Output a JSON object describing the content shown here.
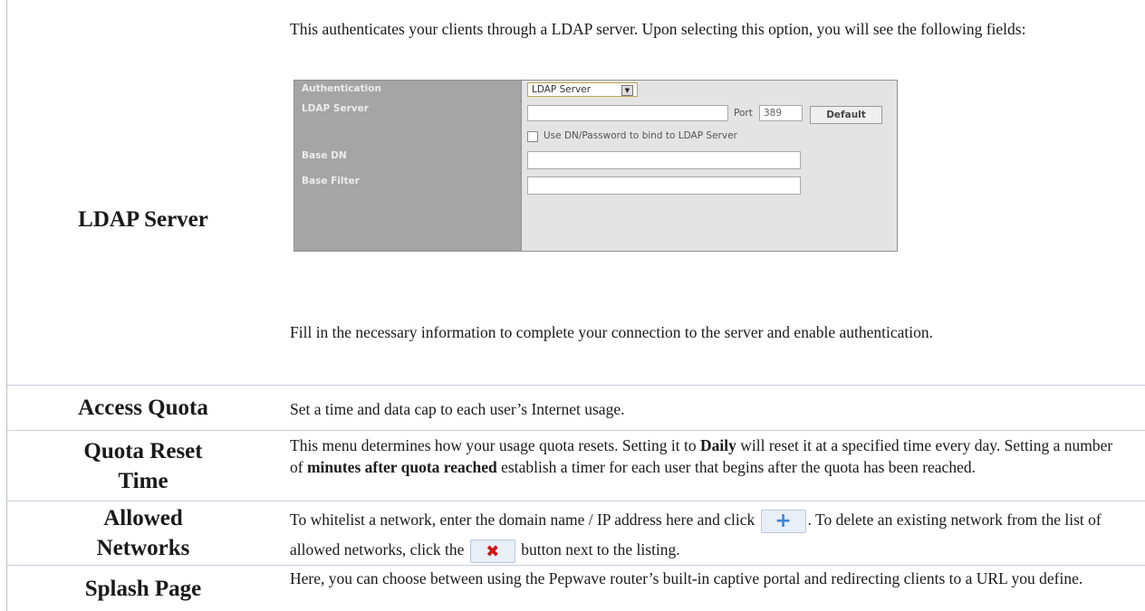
{
  "ldap": {
    "term": "LDAP Server",
    "intro": "This authenticates your clients through a LDAP server. Upon selecting this option, you will see the following fields:",
    "form": {
      "authentication_label": "Authentication",
      "authentication_value": "LDAP Server",
      "ldap_server_label": "LDAP Server",
      "port_label": "Port",
      "port_value": "389",
      "default_button": "Default",
      "bind_checkbox_label": "Use DN/Password to bind to LDAP Server",
      "base_dn_label": "Base DN",
      "base_filter_label": "Base Filter"
    },
    "outro": "Fill in the necessary information to complete your connection to the server and enable authentication."
  },
  "access_quota": {
    "term": "Access Quota",
    "desc": "Set a time and data cap to each user’s Internet usage."
  },
  "quota_reset": {
    "term": "Quota Reset Time",
    "desc_1": "This menu determines how your usage quota resets. Setting it to ",
    "desc_bold_1": "Daily",
    "desc_2": " will reset it at a specified time every day. Setting a number of ",
    "desc_bold_2": "minutes after quota reached",
    "desc_3": " establish a timer for each user that begins after the quota has been reached."
  },
  "allowed_networks": {
    "term": "Allowed Networks",
    "desc_1": "To whitelist a network, enter the domain name / IP address here and click ",
    "add_icon": "plus-icon",
    "desc_2": ". To delete an existing network from the list of allowed networks, click the ",
    "delete_icon": "x-icon",
    "desc_3": " button next to the listing."
  },
  "splash_page": {
    "term": "Splash Page",
    "desc": "Here, you can choose between using the Pepwave router’s built-in captive portal and redirecting clients to a URL you define."
  },
  "colors": {
    "plus": "#3b86d2",
    "cross": "#d01515",
    "form_label_bg": "#a5a5a5"
  }
}
